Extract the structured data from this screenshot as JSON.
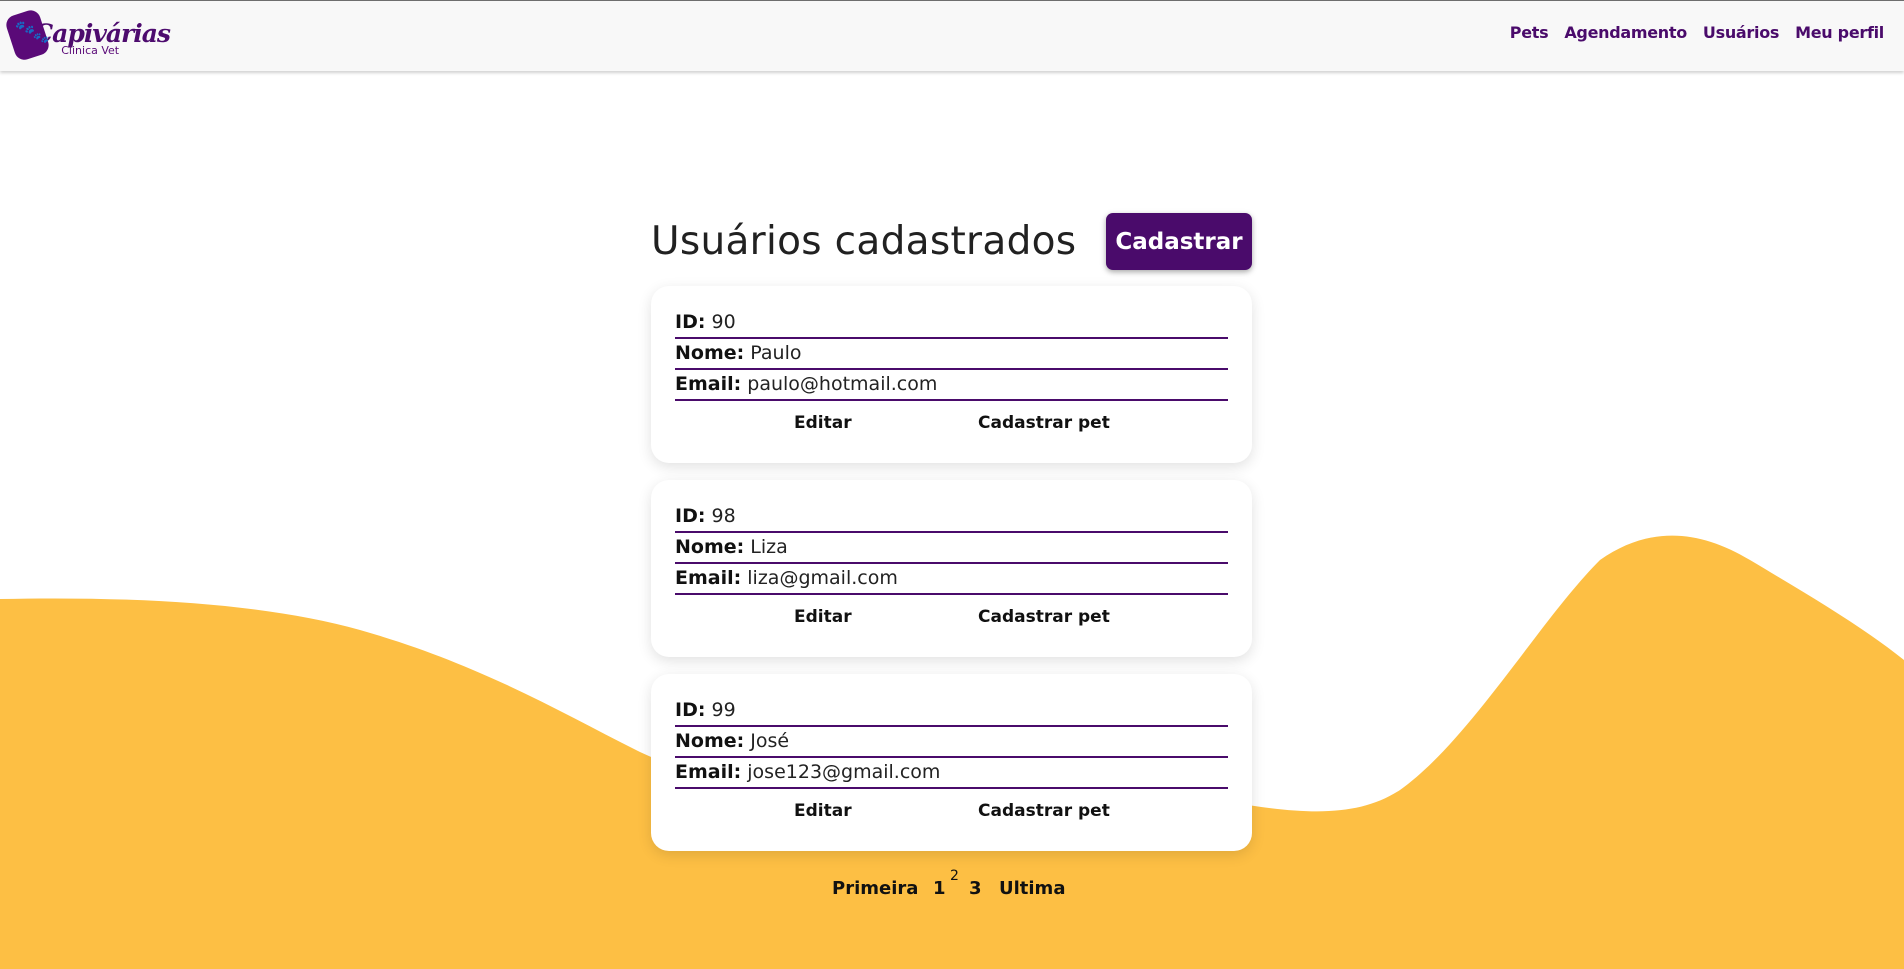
{
  "brand": {
    "name": "Capivárias",
    "subtitle": "Clinica Vet",
    "color": "#4a0b6b",
    "accent_wave": "#fdbf44"
  },
  "nav": {
    "items": [
      {
        "label": "Pets"
      },
      {
        "label": "Agendamento"
      },
      {
        "label": "Usuários"
      },
      {
        "label": "Meu perfil"
      }
    ]
  },
  "page": {
    "title": "Usuários cadastrados",
    "register_label": "Cadastrar"
  },
  "field_labels": {
    "id": "ID:",
    "name": "Nome:",
    "email": "Email:"
  },
  "users": [
    {
      "id": "90",
      "name": "Paulo",
      "email": "paulo@hotmail.com",
      "edit_label": "Editar",
      "add_pet_label": "Cadastrar pet"
    },
    {
      "id": "98",
      "name": "Liza",
      "email": "liza@gmail.com",
      "edit_label": "Editar",
      "add_pet_label": "Cadastrar pet"
    },
    {
      "id": "99",
      "name": "José",
      "email": "jose123@gmail.com",
      "edit_label": "Editar",
      "add_pet_label": "Cadastrar pet"
    }
  ],
  "pagination": {
    "first": "Primeira",
    "pages": [
      "1",
      "2",
      "3"
    ],
    "current": "2",
    "last": "Ultima"
  }
}
